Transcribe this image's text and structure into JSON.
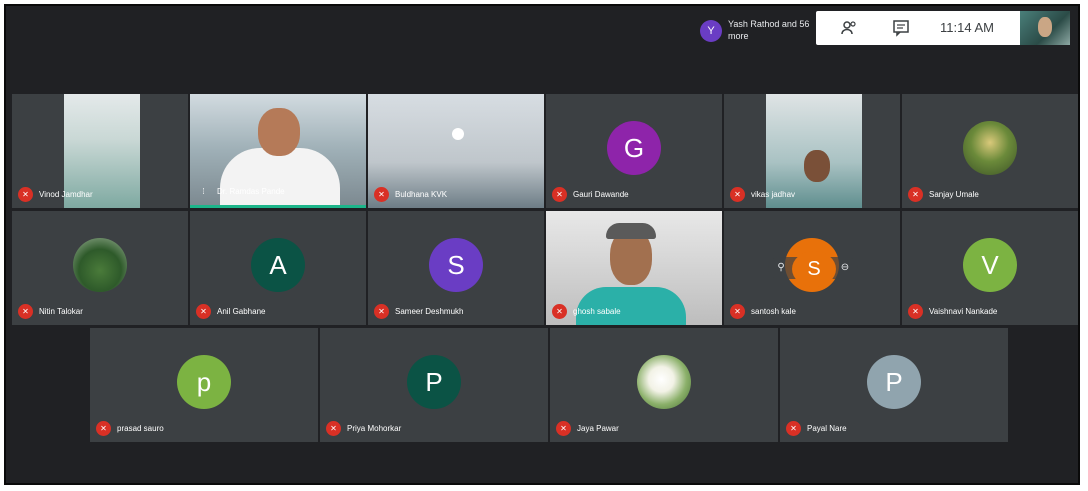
{
  "notification": {
    "avatar_letter": "Y",
    "text": "Yash Rathod and 56 more"
  },
  "toolbar": {
    "people_icon": "people-icon",
    "chat_icon": "chat-icon",
    "time": "11:14 AM"
  },
  "tiles": [
    {
      "name": "Vinod Jamdhar",
      "type": "video"
    },
    {
      "name": "Dr. Ramdas Pande",
      "type": "video"
    },
    {
      "name": "Buldhana KVK",
      "type": "video"
    },
    {
      "name": "Gauri Dawande",
      "type": "avatar",
      "letter": "G",
      "color": "#8e24aa"
    },
    {
      "name": "vikas jadhav",
      "type": "video"
    },
    {
      "name": "Sanjay Umale",
      "type": "photo"
    },
    {
      "name": "Nitin Talokar",
      "type": "photo"
    },
    {
      "name": "Anil Gabhane",
      "type": "avatar",
      "letter": "A",
      "color": "#0b5345"
    },
    {
      "name": "Sameer Deshmukh",
      "type": "avatar",
      "letter": "S",
      "color": "#6a3dc4"
    },
    {
      "name": "ghosh sabale",
      "type": "video"
    },
    {
      "name": "santosh kale",
      "type": "avatar",
      "letter": "S",
      "color": "#e8710a"
    },
    {
      "name": "Vaishnavi Nankade",
      "type": "avatar",
      "letter": "V",
      "color": "#7cb342"
    },
    {
      "name": "prasad sauro",
      "type": "avatar",
      "letter": "p",
      "color": "#7cb342"
    },
    {
      "name": "Priya Mohorkar",
      "type": "avatar",
      "letter": "P",
      "color": "#0b5345"
    },
    {
      "name": "Jaya Pawar",
      "type": "photo"
    },
    {
      "name": "Payal Nare",
      "type": "avatar",
      "letter": "P",
      "color": "#90a4ae"
    }
  ]
}
